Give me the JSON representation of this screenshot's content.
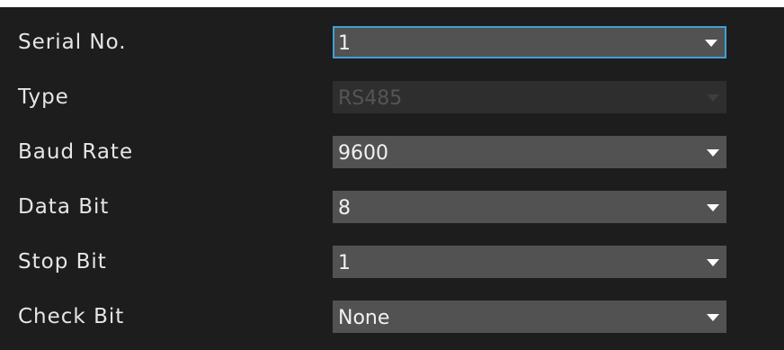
{
  "fields": [
    {
      "label": "Serial No.",
      "value": "1",
      "state": "focused",
      "arrow_icon": "chevron-down-icon"
    },
    {
      "label": "Type",
      "value": "RS485",
      "state": "disabled",
      "arrow_icon": "chevron-down-icon"
    },
    {
      "label": "Baud Rate",
      "value": "9600",
      "state": "normal",
      "arrow_icon": "chevron-down-icon"
    },
    {
      "label": "Data Bit",
      "value": "8",
      "state": "normal",
      "arrow_icon": "chevron-down-icon"
    },
    {
      "label": "Stop Bit",
      "value": "1",
      "state": "normal",
      "arrow_icon": "chevron-down-icon"
    },
    {
      "label": "Check Bit",
      "value": "None",
      "state": "normal",
      "arrow_icon": "chevron-down-icon"
    }
  ],
  "colors": {
    "panel_background": "#1d1d1d",
    "dropdown_background": "#525252",
    "dropdown_disabled_background": "#2e2e2e",
    "focus_border": "#3f9fd6",
    "label_text": "#e6e6e6",
    "value_text": "#f0f0f0",
    "disabled_text": "#555555"
  }
}
